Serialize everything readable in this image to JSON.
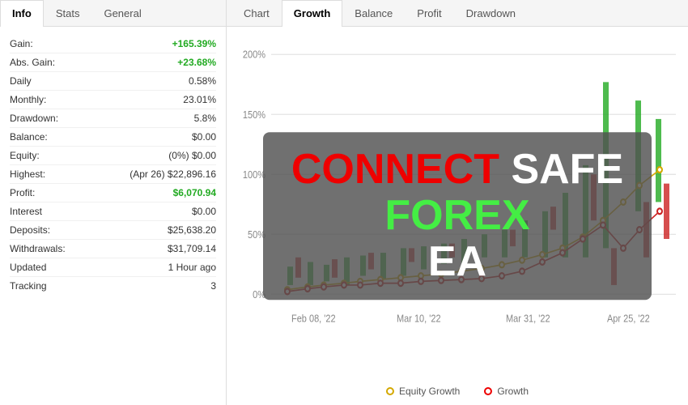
{
  "leftPanel": {
    "tabs": [
      {
        "label": "Info",
        "active": true
      },
      {
        "label": "Stats",
        "active": false
      },
      {
        "label": "General",
        "active": false
      }
    ],
    "rows": [
      {
        "label": "Gain:",
        "value": "+165.39%",
        "class": "value-green"
      },
      {
        "label": "Abs. Gain:",
        "value": "+23.68%",
        "class": "value-green"
      },
      {
        "label": "Daily",
        "value": "0.58%",
        "class": ""
      },
      {
        "label": "Monthly:",
        "value": "23.01%",
        "class": ""
      },
      {
        "label": "Drawdown:",
        "value": "5.8%",
        "class": ""
      },
      {
        "label": "Balance:",
        "value": "$0.00",
        "class": ""
      },
      {
        "label": "Equity:",
        "value": "(0%) $0.00",
        "class": ""
      },
      {
        "label": "Highest:",
        "value": "(Apr 26) $22,896.16",
        "class": ""
      },
      {
        "label": "Profit:",
        "value": "$6,070.94",
        "class": "value-profit"
      },
      {
        "label": "Interest",
        "value": "$0.00",
        "class": ""
      },
      {
        "label": "Deposits:",
        "value": "$25,638.20",
        "class": ""
      },
      {
        "label": "Withdrawals:",
        "value": "$31,709.14",
        "class": ""
      },
      {
        "label": "Updated",
        "value": "1 Hour ago",
        "class": ""
      },
      {
        "label": "Tracking",
        "value": "3",
        "class": ""
      }
    ]
  },
  "rightPanel": {
    "tabs": [
      {
        "label": "Chart",
        "active": false
      },
      {
        "label": "Growth",
        "active": true
      },
      {
        "label": "Balance",
        "active": false
      },
      {
        "label": "Profit",
        "active": false
      },
      {
        "label": "Drawdown",
        "active": false
      }
    ],
    "yLabels": [
      "200%",
      "150%",
      "100%",
      "50%",
      "0%"
    ],
    "xLabels": [
      "Feb 08, '22",
      "Mar 10, '22",
      "Mar 31, '22",
      "Apr 25, '22"
    ],
    "legend": [
      {
        "label": "Equity Growth",
        "color": "equity"
      },
      {
        "label": "Growth",
        "color": "growth"
      }
    ]
  },
  "overlay": {
    "line1_part1": "CONNECT",
    "line1_part2": "SAFE",
    "line1_part3": "FOREX",
    "line2": "EA"
  }
}
